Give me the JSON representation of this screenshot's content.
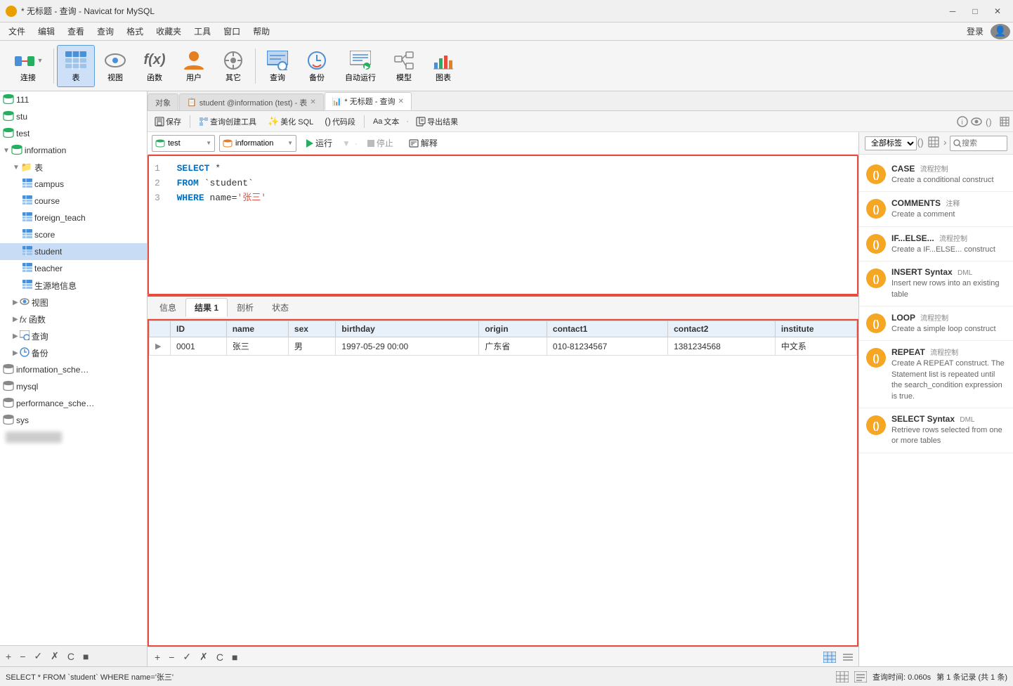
{
  "app": {
    "title": "* 无标题 - 查询 - Navicat for MySQL",
    "login_label": "登录"
  },
  "menubar": {
    "items": [
      "文件",
      "编辑",
      "查看",
      "查询",
      "格式",
      "收藏夹",
      "工具",
      "窗口",
      "帮助"
    ]
  },
  "toolbar": {
    "buttons": [
      {
        "id": "connect",
        "label": "连接",
        "icon": "🔌",
        "active": false
      },
      {
        "id": "table",
        "label": "表",
        "icon": "📋",
        "active": true
      },
      {
        "id": "view",
        "label": "视图",
        "icon": "👁️",
        "active": false
      },
      {
        "id": "function",
        "label": "函数",
        "icon": "fx",
        "active": false
      },
      {
        "id": "user",
        "label": "用户",
        "icon": "👤",
        "active": false
      },
      {
        "id": "other",
        "label": "其它",
        "icon": "🔧",
        "active": false
      },
      {
        "id": "query",
        "label": "查询",
        "icon": "📊",
        "active": false
      },
      {
        "id": "backup",
        "label": "备份",
        "icon": "🔄",
        "active": false
      },
      {
        "id": "autorun",
        "label": "自动运行",
        "icon": "📅",
        "active": false
      },
      {
        "id": "model",
        "label": "模型",
        "icon": "📐",
        "active": false
      },
      {
        "id": "chart",
        "label": "图表",
        "icon": "📈",
        "active": false
      }
    ]
  },
  "sidebar": {
    "scroll_up": "▲",
    "scroll_down": "▼",
    "tree": [
      {
        "id": "111",
        "label": "111",
        "level": 0,
        "type": "db",
        "expanded": false
      },
      {
        "id": "stu",
        "label": "stu",
        "level": 0,
        "type": "db",
        "expanded": false
      },
      {
        "id": "test",
        "label": "test",
        "level": 0,
        "type": "db",
        "expanded": false
      },
      {
        "id": "information",
        "label": "information",
        "level": 0,
        "type": "db",
        "expanded": true
      },
      {
        "id": "tables",
        "label": "表",
        "level": 1,
        "type": "folder",
        "expanded": true
      },
      {
        "id": "campus",
        "label": "campus",
        "level": 2,
        "type": "table"
      },
      {
        "id": "course",
        "label": "course",
        "level": 2,
        "type": "table"
      },
      {
        "id": "foreign_teach",
        "label": "foreign_teach",
        "level": 2,
        "type": "table"
      },
      {
        "id": "score",
        "label": "score",
        "level": 2,
        "type": "table"
      },
      {
        "id": "student",
        "label": "student",
        "level": 2,
        "type": "table",
        "selected": true
      },
      {
        "id": "teacher",
        "label": "teacher",
        "level": 2,
        "type": "table"
      },
      {
        "id": "shengdi",
        "label": "生源地信息",
        "level": 2,
        "type": "table"
      },
      {
        "id": "views",
        "label": "视图",
        "level": 1,
        "type": "folder"
      },
      {
        "id": "functions",
        "label": "函数",
        "level": 1,
        "type": "folder"
      },
      {
        "id": "queries",
        "label": "查询",
        "level": 1,
        "type": "folder"
      },
      {
        "id": "backups",
        "label": "备份",
        "level": 1,
        "type": "folder"
      },
      {
        "id": "information_schema",
        "label": "information_sche…",
        "level": 0,
        "type": "db"
      },
      {
        "id": "mysql",
        "label": "mysql",
        "level": 0,
        "type": "db"
      },
      {
        "id": "performance_schema",
        "label": "performance_sche…",
        "level": 0,
        "type": "db"
      },
      {
        "id": "sys",
        "label": "sys",
        "level": 0,
        "type": "db"
      }
    ],
    "bottom_buttons": [
      "+",
      "−",
      "✓",
      "✗",
      "C",
      "■"
    ]
  },
  "tabs": [
    {
      "id": "object",
      "label": "对象",
      "active": false
    },
    {
      "id": "student_table",
      "label": "student @information (test) - 表",
      "active": false,
      "icon": "📋"
    },
    {
      "id": "query",
      "label": "* 无标题 - 查询",
      "active": true,
      "icon": "📊"
    }
  ],
  "query": {
    "toolbar": {
      "save": "保存",
      "create_tool": "查询创建工具",
      "beautify_sql": "美化 SQL",
      "code_snippet": "代码段",
      "text": "文本",
      "export": "导出结果"
    },
    "db_selector": {
      "db1": "test",
      "db2": "information",
      "run": "运行",
      "stop": "停止",
      "explain": "解释"
    },
    "sql_lines": [
      {
        "num": 1,
        "tokens": [
          {
            "type": "kw",
            "text": "SELECT"
          },
          {
            "type": "val",
            "text": " *"
          }
        ]
      },
      {
        "num": 2,
        "tokens": [
          {
            "type": "kw",
            "text": "FROM"
          },
          {
            "type": "val",
            "text": " `student`"
          }
        ]
      },
      {
        "num": 3,
        "tokens": [
          {
            "type": "kw",
            "text": "WHERE"
          },
          {
            "type": "val",
            "text": " name="
          },
          {
            "type": "str",
            "text": "'张三'"
          }
        ]
      }
    ]
  },
  "results": {
    "tabs": [
      "信息",
      "结果 1",
      "剖析",
      "状态"
    ],
    "active_tab": "结果 1",
    "columns": [
      "ID",
      "name",
      "sex",
      "birthday",
      "origin",
      "contact1",
      "contact2",
      "institute"
    ],
    "rows": [
      {
        "indicator": "▶",
        "ID": "0001",
        "name": "张三",
        "sex": "男",
        "birthday": "1997-05-29 00:00",
        "origin": "广东省",
        "contact1": "010-81234567",
        "contact2": "1381234568",
        "institute": "中文系"
      }
    ]
  },
  "snippet_panel": {
    "tag_label": "全部标签",
    "search_placeholder": "搜索",
    "items": [
      {
        "id": "case",
        "title": "CASE",
        "tag": "流程控制",
        "desc": "Create a conditional construct",
        "icon": "()",
        "icon_color": "orange"
      },
      {
        "id": "comments",
        "title": "COMMENTS",
        "tag": "注释",
        "desc": "Create a comment",
        "icon": "()",
        "icon_color": "orange"
      },
      {
        "id": "if_else",
        "title": "IF...ELSE...",
        "tag": "流程控制",
        "desc": "Create a IF...ELSE... construct",
        "icon": "()",
        "icon_color": "orange"
      },
      {
        "id": "insert_syntax",
        "title": "INSERT Syntax",
        "tag": "DML",
        "desc": "Insert new rows into an existing table",
        "icon": "()",
        "icon_color": "orange"
      },
      {
        "id": "loop",
        "title": "LOOP",
        "tag": "流程控制",
        "desc": "Create a simple loop construct",
        "icon": "()",
        "icon_color": "orange"
      },
      {
        "id": "repeat",
        "title": "REPEAT",
        "tag": "流程控制",
        "desc": "Create A REPEAT construct. The Statement list is repeated until the search_condition expression is true.",
        "icon": "()",
        "icon_color": "orange"
      },
      {
        "id": "select_syntax",
        "title": "SELECT Syntax",
        "tag": "DML",
        "desc": "Retrieve rows selected from one or more tables",
        "icon": "()",
        "icon_color": "orange"
      }
    ]
  },
  "statusbar": {
    "sql": "SELECT * FROM `student` WHERE name='张三'",
    "time": "查询时间: 0.060s",
    "records": "第 1 条记录 (共 1 条)"
  }
}
